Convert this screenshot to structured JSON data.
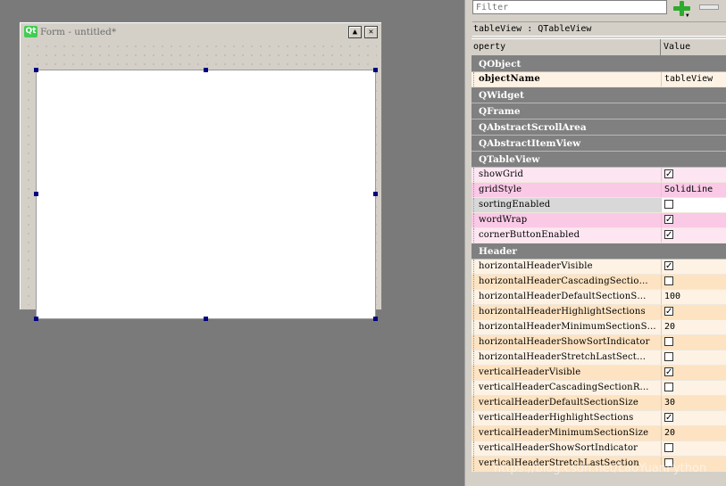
{
  "form": {
    "title": "Form - untitled*",
    "logo": "Qt",
    "minimize_glyph": "▲",
    "close_glyph": "✕"
  },
  "dock": {
    "filter_placeholder": "Filter",
    "add_arrow": "▼",
    "object_label": "tableView : QTableView",
    "header": {
      "property": "operty",
      "value": "Value"
    }
  },
  "rows": [
    {
      "type": "group",
      "label": "QObject"
    },
    {
      "type": "prop",
      "name": "objectName",
      "value": "tableView",
      "bold": true,
      "bg": "#fdf2e4"
    },
    {
      "type": "group",
      "label": "QWidget"
    },
    {
      "type": "group",
      "label": "QFrame"
    },
    {
      "type": "group",
      "label": "QAbstractScrollArea"
    },
    {
      "type": "group",
      "label": "QAbstractItemView"
    },
    {
      "type": "group",
      "label": "QTableView"
    },
    {
      "type": "prop",
      "name": "showGrid",
      "checkbox": true,
      "checked": true,
      "bg": "#fde6f2"
    },
    {
      "type": "prop",
      "name": "gridStyle",
      "value": "SolidLine",
      "bg": "#fac9e6"
    },
    {
      "type": "prop",
      "name": "sortingEnabled",
      "checkbox": true,
      "checked": false,
      "bg": "#d8d8d8",
      "valbg": "#ffffff"
    },
    {
      "type": "prop",
      "name": "wordWrap",
      "checkbox": true,
      "checked": true,
      "bg": "#fac9e6"
    },
    {
      "type": "prop",
      "name": "cornerButtonEnabled",
      "checkbox": true,
      "checked": true,
      "bg": "#fde6f2"
    },
    {
      "type": "group",
      "label": "Header"
    },
    {
      "type": "prop",
      "name": "horizontalHeaderVisible",
      "checkbox": true,
      "checked": true,
      "bg": "#fdf2e4"
    },
    {
      "type": "prop",
      "name": "horizontalHeaderCascadingSectio…",
      "checkbox": true,
      "checked": false,
      "bg": "#fde3c2"
    },
    {
      "type": "prop",
      "name": "horizontalHeaderDefaultSectionS…",
      "value": "100",
      "bg": "#fdf2e4"
    },
    {
      "type": "prop",
      "name": "horizontalHeaderHighlightSections",
      "checkbox": true,
      "checked": true,
      "bg": "#fde3c2"
    },
    {
      "type": "prop",
      "name": "horizontalHeaderMinimumSectionS…",
      "value": "20",
      "bg": "#fdf2e4"
    },
    {
      "type": "prop",
      "name": "horizontalHeaderShowSortIndicator",
      "checkbox": true,
      "checked": false,
      "bg": "#fde3c2"
    },
    {
      "type": "prop",
      "name": "horizontalHeaderStretchLastSect…",
      "checkbox": true,
      "checked": false,
      "bg": "#fdf2e4"
    },
    {
      "type": "prop",
      "name": "verticalHeaderVisible",
      "checkbox": true,
      "checked": true,
      "bg": "#fde3c2"
    },
    {
      "type": "prop",
      "name": "verticalHeaderCascadingSectionR…",
      "checkbox": true,
      "checked": false,
      "bg": "#fdf2e4"
    },
    {
      "type": "prop",
      "name": "verticalHeaderDefaultSectionSize",
      "value": "30",
      "bg": "#fde3c2"
    },
    {
      "type": "prop",
      "name": "verticalHeaderHighlightSections",
      "checkbox": true,
      "checked": true,
      "bg": "#fdf2e4"
    },
    {
      "type": "prop",
      "name": "verticalHeaderMinimumSectionSize",
      "value": "20",
      "bg": "#fde3c2"
    },
    {
      "type": "prop",
      "name": "verticalHeaderShowSortIndicator",
      "checkbox": true,
      "checked": false,
      "bg": "#fdf2e4"
    },
    {
      "type": "prop",
      "name": "verticalHeaderStretchLastSection",
      "checkbox": true,
      "checked": false,
      "bg": "#fde3c2"
    }
  ],
  "watermark": "https://blog.csdn.net/LaoYuanPython"
}
